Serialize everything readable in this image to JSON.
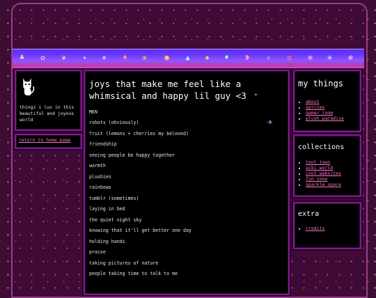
{
  "left": {
    "tagline": "thingz i luv in this beautiful and joyous world",
    "home_link": "return to home page"
  },
  "main": {
    "title": "joys that make me feel like a whimsical and happy lil guy <3",
    "items": [
      "MEN",
      "robots (obviously)",
      "fruit (lemons + cherries my beloved)",
      "friendship",
      "seeing people be happy together",
      "warmth",
      "plushies",
      "rainbows",
      "tumblr (sometimes)",
      "laying in bed",
      "the quiet night sky",
      "knowing that it'll get better one day",
      "holding hands",
      "praise",
      "taking pictures of nature",
      "people taking time to talk to me"
    ]
  },
  "right": {
    "my_things": {
      "title": "my things",
      "links": [
        "about",
        "sprites",
        "gamer room",
        "plush paradise"
      ]
    },
    "collections": {
      "title": "collections",
      "links": [
        "tool town",
        "wiki world",
        "cool websites",
        "fun zone",
        "sparkle space"
      ]
    },
    "extra": {
      "title": "extra",
      "links": [
        "credits"
      ]
    }
  },
  "banner_sprites": [
    "pokemon-sprite",
    "pokemon-sprite",
    "pokemon-sprite",
    "pokemon-sprite",
    "pokemon-sprite",
    "pokemon-sprite",
    "pokemon-sprite",
    "pokemon-sprite",
    "pokemon-sprite",
    "pokemon-sprite",
    "pokemon-sprite",
    "pokemon-sprite",
    "pokemon-sprite",
    "pokemon-sprite",
    "pokemon-sprite",
    "pokemon-sprite",
    "pokemon-sprite",
    "pokemon-sprite",
    "pokemon-sprite",
    "pokemon-sprite"
  ],
  "colors": {
    "background": "#3d0d33",
    "panel_border": "#7d1a8f",
    "link": "#ff77c8",
    "banner_top": "#5a2bff",
    "banner_bottom": "#d03b9a"
  }
}
